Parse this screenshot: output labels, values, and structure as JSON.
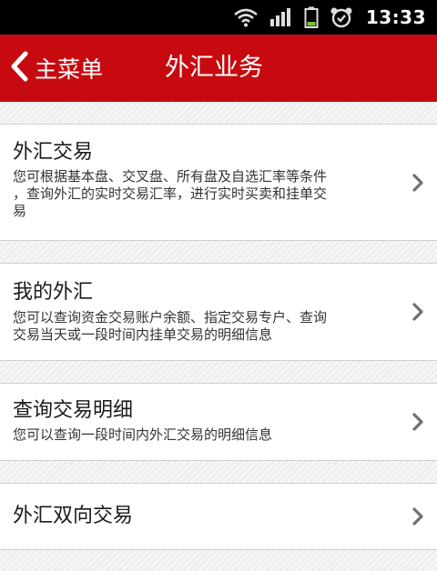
{
  "statusbar": {
    "time": "13:33",
    "icons": [
      "wifi-icon",
      "signal-icon",
      "battery-icon",
      "alarm-icon"
    ]
  },
  "navbar": {
    "back_label": "主菜单",
    "title": "外汇业务",
    "color": "#c70a0f"
  },
  "menu": {
    "items": [
      {
        "title": "外汇交易",
        "desc_lines": [
          "您可根据基本盘、交叉盘、所有盘及自选汇率等条件",
          "，查询外汇的实时交易汇率，进行实时买卖和挂单交",
          "易"
        ]
      },
      {
        "title": "我的外汇",
        "desc_lines": [
          "您可以查询资金交易账户余额、指定交易专户、查询",
          "交易当天或一段时间内挂单交易的明细信息"
        ]
      },
      {
        "title": "查询交易明细",
        "desc_lines": [
          "您可以查询一段时间内外汇交易的明细信息"
        ]
      },
      {
        "title": "外汇双向交易",
        "desc_lines": []
      }
    ]
  }
}
